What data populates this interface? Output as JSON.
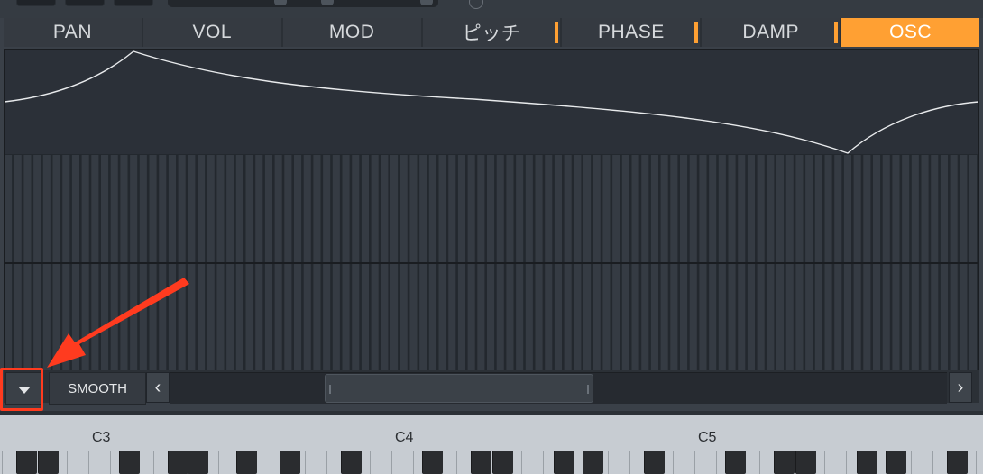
{
  "tabs": [
    {
      "label": "PAN",
      "active": false,
      "marker": false
    },
    {
      "label": "VOL",
      "active": false,
      "marker": false
    },
    {
      "label": "MOD",
      "active": false,
      "marker": false
    },
    {
      "label": "ピッチ",
      "active": false,
      "marker": true
    },
    {
      "label": "PHASE",
      "active": false,
      "marker": true
    },
    {
      "label": "DAMP",
      "active": false,
      "marker": true
    },
    {
      "label": "OSC",
      "active": true,
      "marker": false
    }
  ],
  "bottom": {
    "smooth_label": "SMOOTH",
    "scroll_left": "‹",
    "scroll_right": "›",
    "dropdown_icon": "triangle-down-icon"
  },
  "keyboard": {
    "octaves": [
      "C3",
      "C4",
      "C5"
    ]
  },
  "colors": {
    "accent": "#ffa033",
    "annotation": "#ff3b1f"
  }
}
